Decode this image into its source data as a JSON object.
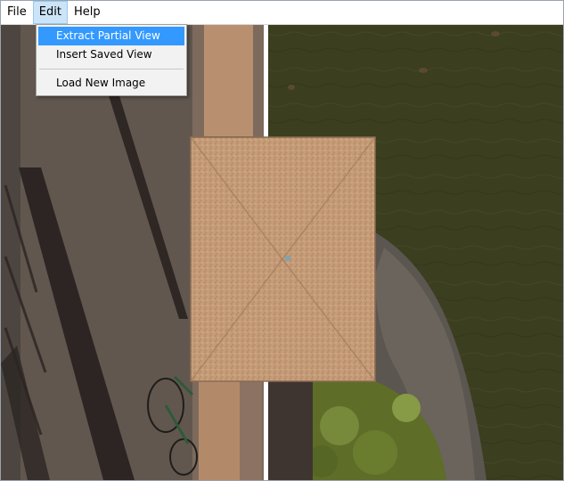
{
  "menubar": {
    "file_label": "File",
    "edit_label": "Edit",
    "help_label": "Help"
  },
  "edit_menu": {
    "items": [
      {
        "label": "Extract Partial View",
        "highlighted": true
      },
      {
        "label": "Insert Saved View",
        "highlighted": false
      },
      {
        "label": "Load New Image",
        "highlighted": false
      }
    ]
  },
  "image": {
    "description_icon": "aerial-photo",
    "colors": {
      "river": "#3a3d1e",
      "pavement": "#5f5550",
      "roof": "#c9a07a",
      "wall": "#b58d6e",
      "shadow": "#2a2220",
      "foliage": "#6b7a2c"
    }
  }
}
